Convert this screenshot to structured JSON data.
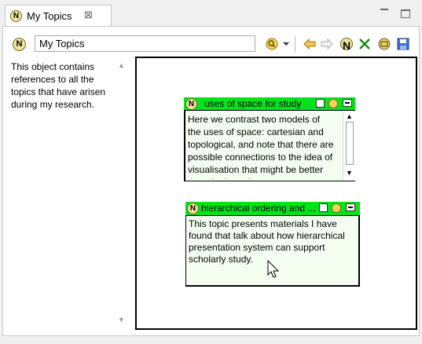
{
  "tab": {
    "icon_letter": "N",
    "title": "My Topics",
    "close_glyph": "⊠"
  },
  "toolbar": {
    "icon_letter": "N",
    "title_value": "My Topics",
    "icons": [
      "find-icon",
      "dropdown-arrow-icon",
      "back-icon",
      "forward-icon",
      "node-icon",
      "unlink-icon",
      "tree-icon",
      "save-icon"
    ]
  },
  "description": {
    "text": "This object contains references to all the topics that have arisen during my research."
  },
  "nodes": [
    {
      "icon_letter": "N",
      "title": "uses of space for study",
      "body": "Here we contrast two models of the uses of space: cartesian and topological, and note that there are possible connections to the idea of visualisation that might be better thought through."
    },
    {
      "icon_letter": "N",
      "title": "hierarchical ordering and ...",
      "body": "This topic presents materials I have found that talk about how hierarchical presentation system can support scholarly study."
    }
  ],
  "colors": {
    "node_header": "#00e21a",
    "node_body": "#f4fff2"
  }
}
